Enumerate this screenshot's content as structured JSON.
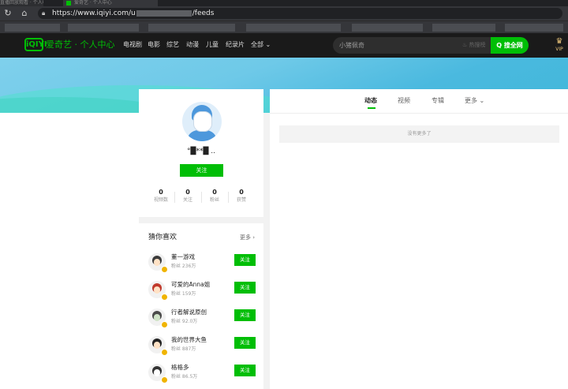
{
  "browser": {
    "tab_text": "直播回放观看 · 个人中心",
    "tab2_text": "爱奇艺 · 个人中心",
    "url_prefix": "https://www.iqiyi.com/u",
    "url_suffix": "/feeds"
  },
  "site": {
    "logo": "iQIYI",
    "brand": "爱奇艺 · 个人中心",
    "nav": [
      "电视剧",
      "电影",
      "综艺",
      "动漫",
      "儿童",
      "纪录片",
      "全部 ⌄"
    ],
    "search_placeholder": "小猪佩奇",
    "hot_label": "♨ 热搜榜",
    "search_button": "Q 搜全网",
    "vip_label": "VIP"
  },
  "profile": {
    "username": "°█**█ ..",
    "follow_button": "关注",
    "stats": [
      {
        "value": "0",
        "label": "视频数"
      },
      {
        "value": "0",
        "label": "关注"
      },
      {
        "value": "0",
        "label": "粉丝"
      },
      {
        "value": "0",
        "label": "获赞"
      }
    ]
  },
  "guess": {
    "title": "猜你喜欢",
    "more": "更多 ›",
    "items": [
      {
        "name": "董一游戏",
        "fans": "粉丝 236万",
        "button": "关注"
      },
      {
        "name": "可爱的Anna姐",
        "fans": "粉丝 159万",
        "button": "关注"
      },
      {
        "name": "行者解说原创",
        "fans": "粉丝 92.0万",
        "button": "关注"
      },
      {
        "name": "我的世界大鱼",
        "fans": "粉丝 887万",
        "button": "关注"
      },
      {
        "name": "格格多",
        "fans": "粉丝 86.5万",
        "button": "关注"
      }
    ]
  },
  "feed": {
    "tabs": [
      "动态",
      "视频",
      "专辑",
      "更多 ⌄"
    ],
    "active_tab": "动态",
    "empty_text": "没有更多了"
  },
  "colors": {
    "accent": "#00be06",
    "header_bg": "#1a1a1a",
    "banner": "#5cc3e4"
  }
}
